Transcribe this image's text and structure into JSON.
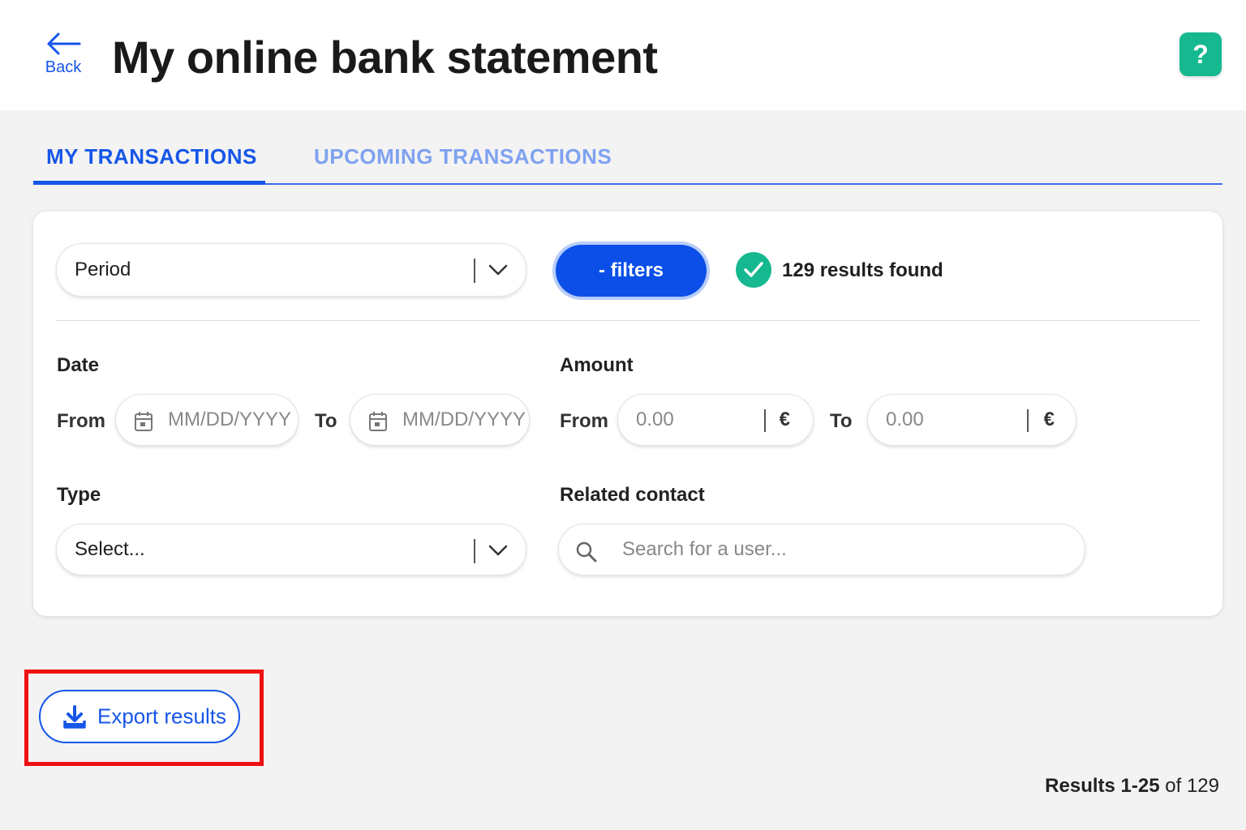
{
  "header": {
    "back_label": "Back",
    "title": "My online bank statement",
    "help_label": "?"
  },
  "tabs": [
    {
      "label": "MY TRANSACTIONS",
      "active": true
    },
    {
      "label": "UPCOMING TRANSACTIONS",
      "active": false
    }
  ],
  "filters": {
    "period": {
      "value": "Period"
    },
    "toggle_label": "- filters",
    "results_found": "129 results found",
    "date": {
      "label": "Date",
      "from_label": "From",
      "from_placeholder": "MM/DD/YYYY",
      "to_label": "To",
      "to_placeholder": "MM/DD/YYYY"
    },
    "amount": {
      "label": "Amount",
      "from_label": "From",
      "from_placeholder": "0.00",
      "to_label": "To",
      "to_placeholder": "0.00",
      "currency": "€"
    },
    "type": {
      "label": "Type",
      "value": "Select..."
    },
    "related_contact": {
      "label": "Related contact",
      "placeholder": "Search for a user..."
    }
  },
  "export": {
    "label": "Export results"
  },
  "pagination": {
    "prefix": "Results ",
    "range": "1-25",
    "suffix": " of 129"
  },
  "colors": {
    "accent": "#1656e8",
    "help": "#16b890",
    "success": "#16b890",
    "highlight": "#ee1111"
  }
}
